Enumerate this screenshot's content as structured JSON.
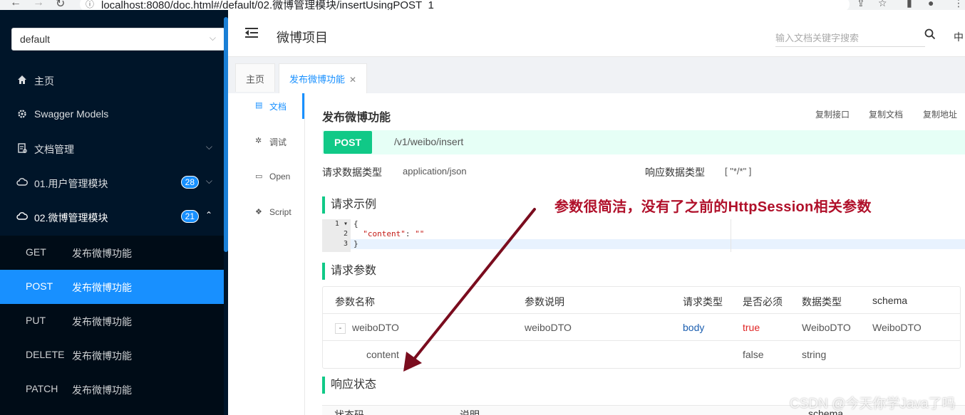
{
  "browser": {
    "url": "localhost:8080/doc.html#/default/02.微博管理模块/insertUsingPOST_1"
  },
  "sidebar": {
    "group_select": "default",
    "items": [
      {
        "label": "主页",
        "icon": "home-icon"
      },
      {
        "label": "Swagger Models",
        "icon": "gear-icon"
      },
      {
        "label": "文档管理",
        "icon": "doc-manage-icon"
      },
      {
        "label": "01.用户管理模块",
        "icon": "cloud-icon",
        "badge": "28"
      },
      {
        "label": "02.微博管理模块",
        "icon": "cloud-icon",
        "badge": "21"
      }
    ],
    "sub_items": [
      {
        "method": "GET",
        "name": "发布微博功能"
      },
      {
        "method": "POST",
        "name": "发布微博功能",
        "active": true
      },
      {
        "method": "PUT",
        "name": "发布微博功能"
      },
      {
        "method": "DELETE",
        "name": "发布微博功能"
      },
      {
        "method": "PATCH",
        "name": "发布微博功能"
      }
    ]
  },
  "header": {
    "title": "微博项目",
    "search_placeholder": "输入文档关键字搜索",
    "lang": "中"
  },
  "tabs": [
    {
      "label": "主页"
    },
    {
      "label": "发布微博功能",
      "active": true
    }
  ],
  "vtabs": [
    {
      "label": "文档",
      "icon": "doc-icon",
      "active": true
    },
    {
      "label": "调试",
      "icon": "bug-icon"
    },
    {
      "label": "Open",
      "icon": "file-icon"
    },
    {
      "label": "Script",
      "icon": "script-icon"
    }
  ],
  "operation": {
    "title": "发布微博功能",
    "copy_api": "复制接口",
    "copy_doc": "复制文档",
    "copy_url": "复制地址",
    "method": "POST",
    "path": "/v1/weibo/insert",
    "req_type_label": "请求数据类型",
    "req_type": "application/json",
    "resp_type_label": "响应数据类型",
    "resp_type": "[ \"*/*\" ]"
  },
  "sections": {
    "example": "请求示例",
    "params": "请求参数",
    "resp_status": "响应状态"
  },
  "code": {
    "lines": [
      {
        "n": "1",
        "text": "{"
      },
      {
        "n": "2",
        "key": "\"content\"",
        "sep": ": ",
        "val": "\"\""
      },
      {
        "n": "3",
        "text": "}"
      }
    ]
  },
  "params_table": {
    "headers": [
      "参数名称",
      "参数说明",
      "请求类型",
      "是否必须",
      "数据类型",
      "schema"
    ],
    "rows": [
      {
        "name": "weiboDTO",
        "desc": "weiboDTO",
        "in": "body",
        "required": "true",
        "type": "WeiboDTO",
        "schema": "WeiboDTO",
        "expand": "-"
      },
      {
        "name": "content",
        "desc": "",
        "in": "",
        "required": "false",
        "type": "string",
        "schema": ""
      }
    ]
  },
  "resp_table": {
    "headers": [
      "状态码",
      "说明",
      "schema"
    ]
  },
  "annotation": "参数很简洁，没有了之前的HttpSession相关参数",
  "watermark": "CSDN @今天你学Java了吗",
  "colors": {
    "sidebar_bg": "#001529",
    "accent": "#1890ff",
    "post_green": "#10c987",
    "annotation_red": "#b0102a"
  }
}
